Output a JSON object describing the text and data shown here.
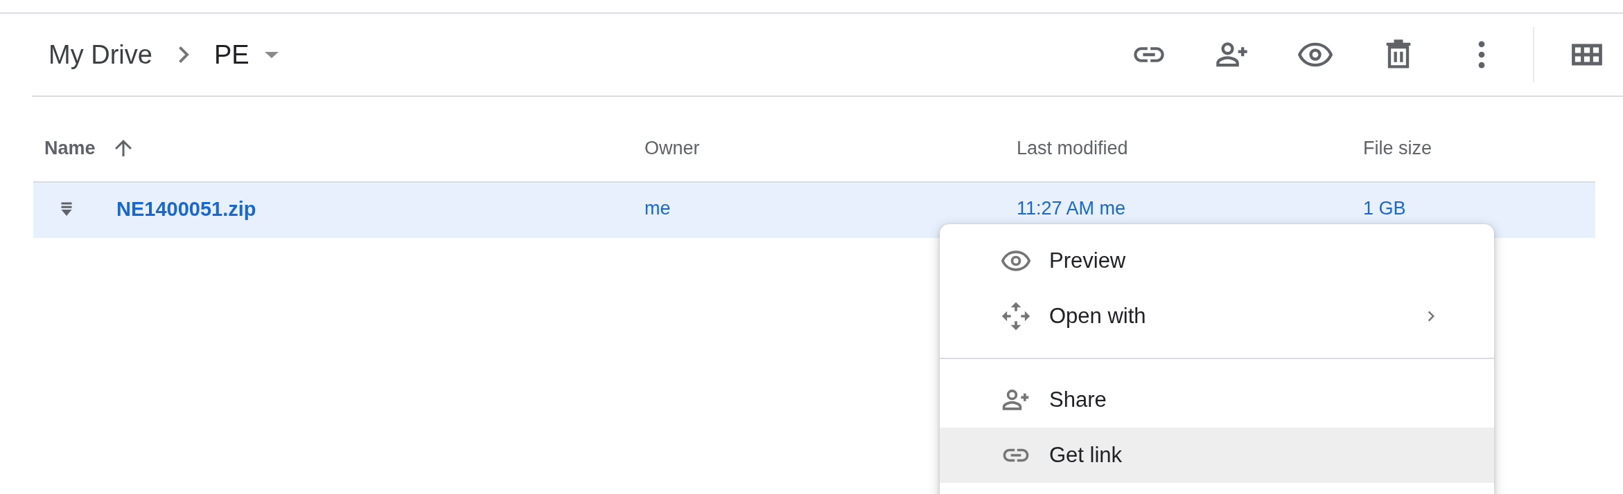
{
  "breadcrumb": [
    {
      "label": "My Drive"
    },
    {
      "label": "PE",
      "has_dropdown": true
    }
  ],
  "table": {
    "columns": [
      {
        "label": "Name",
        "sorted": true
      },
      {
        "label": "Owner",
        "sorted": false
      },
      {
        "label": "Last modified",
        "sorted": false
      },
      {
        "label": "File size",
        "sorted": false
      }
    ],
    "rows": [
      {
        "name": "NE1400051.zip",
        "owner": "me",
        "last_modified": "11:27 AM me",
        "file_size": "1 GB",
        "selected": true
      }
    ]
  },
  "context_menu": {
    "sections": [
      [
        {
          "label": "Preview",
          "has_submenu": false,
          "selected": false
        },
        {
          "label": "Open with",
          "has_submenu": true,
          "selected": false
        }
      ],
      [
        {
          "label": "Share",
          "has_submenu": false,
          "selected": false
        },
        {
          "label": "Get link",
          "has_submenu": false,
          "selected": true
        }
      ]
    ]
  }
}
